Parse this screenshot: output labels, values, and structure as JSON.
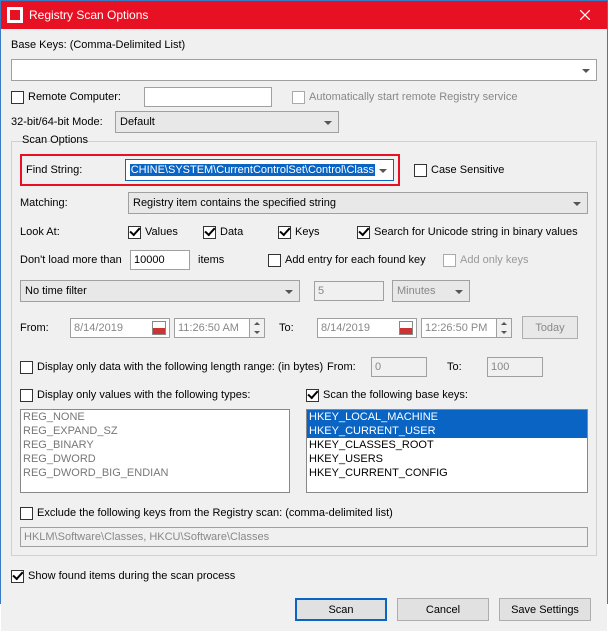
{
  "title": "Registry Scan Options",
  "baseKeysLabel": "Base Keys:  (Comma-Delimited List)",
  "baseKeysValue": "",
  "remoteComputer": {
    "label": "Remote Computer:",
    "checked": false,
    "value": "",
    "autoLabel": "Automatically start remote Registry service",
    "autoChecked": false
  },
  "bitMode": {
    "label": "32-bit/64-bit Mode:",
    "value": "Default"
  },
  "scanLegend": "Scan Options",
  "findString": {
    "label": "Find String:",
    "value": "CHINE\\SYSTEM\\CurrentControlSet\\Control\\Class"
  },
  "caseSensitive": {
    "label": "Case Sensitive",
    "checked": false
  },
  "matching": {
    "label": "Matching:",
    "value": "Registry item contains the specified string"
  },
  "lookAt": {
    "label": "Look At:",
    "values": {
      "label": "Values",
      "checked": true
    },
    "data": {
      "label": "Data",
      "checked": true
    },
    "keys": {
      "label": "Keys",
      "checked": true
    },
    "unicode": {
      "label": "Search for Unicode string in binary values",
      "checked": true
    }
  },
  "dontLoad": {
    "label1": "Don't load more than",
    "value": "10000",
    "label2": "items"
  },
  "addEntry": {
    "label": "Add entry for each found key",
    "checked": false
  },
  "addOnlyKeys": {
    "label": "Add only keys",
    "checked": false
  },
  "timeFilter": {
    "value": "No time filter",
    "num": "5",
    "unit": "Minutes"
  },
  "fromDate": {
    "label": "From:",
    "date": "8/14/2019",
    "time": "11:26:50 AM"
  },
  "toDate": {
    "label": "To:",
    "date": "8/14/2019",
    "time": "12:26:50 PM"
  },
  "today": "Today",
  "lenRange": {
    "label": "Display only data with the following length range: (in bytes)",
    "checked": false,
    "fromLbl": "From:",
    "from": "0",
    "toLbl": "To:",
    "to": "100"
  },
  "valTypes": {
    "label": "Display only values with the following types:",
    "checked": false,
    "items": [
      "REG_NONE",
      "",
      "REG_EXPAND_SZ",
      "REG_BINARY",
      "REG_DWORD",
      "REG_DWORD_BIG_ENDIAN"
    ]
  },
  "baseKeysList": {
    "label": "Scan the following base keys:",
    "checked": true,
    "items": [
      "HKEY_LOCAL_MACHINE",
      "HKEY_CURRENT_USER",
      "HKEY_CLASSES_ROOT",
      "HKEY_USERS",
      "HKEY_CURRENT_CONFIG"
    ]
  },
  "exclude": {
    "label": "Exclude the following keys from the Registry scan: (comma-delimited list)",
    "checked": false,
    "value": "HKLM\\Software\\Classes, HKCU\\Software\\Classes"
  },
  "showFound": {
    "label": "Show found items during the scan process",
    "checked": true
  },
  "buttons": {
    "scan": "Scan",
    "cancel": "Cancel",
    "save": "Save Settings"
  }
}
